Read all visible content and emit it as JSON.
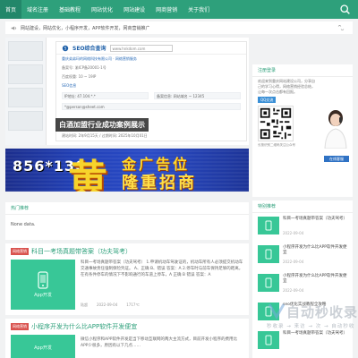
{
  "nav": {
    "items": [
      {
        "label": "首页",
        "active": true
      },
      {
        "label": "域名注册"
      },
      {
        "label": "基础教程"
      },
      {
        "label": "网站优化"
      },
      {
        "label": "网站建设"
      },
      {
        "label": "网商营销"
      },
      {
        "label": "关于我们"
      }
    ],
    "search_icon": "search-icon"
  },
  "ticker": {
    "text": "网站建设，网站优化，小程序开发，APP软件开发，网商营销推广"
  },
  "slider": {
    "seo": {
      "logo": "SEO综合查询",
      "url": "www.hnkdom.com",
      "site_line": "重庆弟弟玛的网络科技有限公司 · 网络营销服务",
      "lines": [
        "备案号: 渝ICP备20001-1号",
        "百度权重: 10 ~ 19IP",
        "SEO信息",
        "IP地址: 47.104.*.*",
        "备案信息: 网站域名 ~ 12345",
        "建站时间: 2年9月15天 / 过期时间: 2025年10月01日"
      ],
      "email": "*@person@sheet.com"
    },
    "caption": "白酒加盟行业成功案例展示"
  },
  "banner": {
    "number": "856*130",
    "big_char": "黄",
    "line1": "金广告位",
    "line2": "隆重招商"
  },
  "hot": {
    "title": "热门推荐",
    "body": "None data."
  },
  "posts": [
    {
      "tag": "网络营销",
      "title": "科目一考场真题带答案（功夫驾考）",
      "thumb_text": "App开发",
      "excerpt": "科目一考场真题带答案（功夫驾考） 1.申请机动车驾驶证的，机动车所有人必须提交机动车交通事故责任强制保险凭证。 A、正确 B、错误 答案：A 2.停车时与前车保持足够的距离，在有条件停车的情况下不影响通行的车道上停车，A 正确 B 错误 答案：A",
      "meta": [
        "陆超",
        "2022-09-04",
        "1717℃"
      ]
    },
    {
      "tag": "网络营销",
      "title": "小程序开发为什么比APP软件开发便宜",
      "thumb_text": "App开发",
      "excerpt": "微信小程序和APP软件开发是当下移动互联网的两大主流方式，目前开发小程序的费用比APP少很多，原因有以下几点……"
    }
  ],
  "subscribe": {
    "title": "注册登录",
    "text": "欢迎来到重庆网站建设公司，分享自己的学习心得，网络营销经验总结，让每一次点击都有回报。",
    "qq_label": "QQ交流",
    "qr_caption": "长按识别二维码关注公众号",
    "avatar_label": "在线客服"
  },
  "recommend": {
    "title": "特别推荐",
    "items": [
      {
        "title": "科目一考场真题带答案（功夫驾考）",
        "date": "2022-09-04"
      },
      {
        "title": "小程序开发为什么比APP软件开发便宜",
        "date": "2022-09-04"
      },
      {
        "title": "小程序开发为什么比APP软件开发便宜",
        "date": "2022-09-04"
      },
      {
        "title": "seo优化实战教程全攻略",
        "date": ""
      },
      {
        "title": "科目一考场真题带答案（功夫驾考）",
        "date": ""
      }
    ]
  },
  "watermark": {
    "main": "自动秒收录",
    "sub": "秒收录 → 来访 → 次 → 自动秒收"
  },
  "colors": {
    "brand": "#2ea07b",
    "tag": "#d9534f",
    "thumb": "#38c797"
  }
}
